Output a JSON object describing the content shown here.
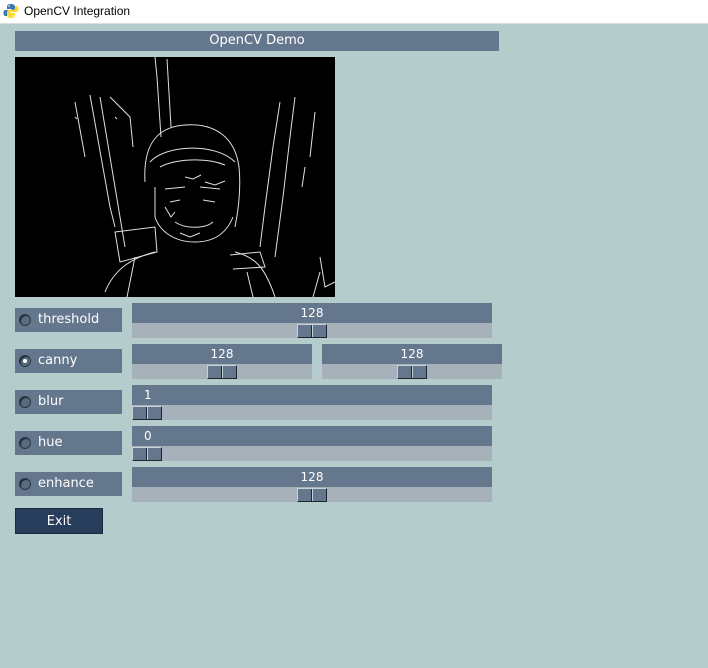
{
  "window": {
    "title": "OpenCV Integration"
  },
  "banner": {
    "text": "OpenCV Demo"
  },
  "controls": [
    {
      "label": "threshold",
      "checked": false,
      "sliders": [
        {
          "value": "128",
          "level": 0.5
        }
      ]
    },
    {
      "label": "canny",
      "checked": true,
      "sliders": [
        {
          "value": "128",
          "level": 0.5
        },
        {
          "value": "128",
          "level": 0.5
        }
      ]
    },
    {
      "label": "blur",
      "checked": false,
      "sliders": [
        {
          "value": "1",
          "level": 0.0
        }
      ]
    },
    {
      "label": "hue",
      "checked": false,
      "sliders": [
        {
          "value": "0",
          "level": 0.0
        }
      ]
    },
    {
      "label": "enhance",
      "checked": false,
      "sliders": [
        {
          "value": "128",
          "level": 0.5
        }
      ]
    }
  ],
  "exit_button": {
    "label": "Exit"
  },
  "colors": {
    "background": "#b4cccc",
    "panel": "#64778d",
    "trough": "#a7b1b9",
    "button": "#283c5c"
  }
}
